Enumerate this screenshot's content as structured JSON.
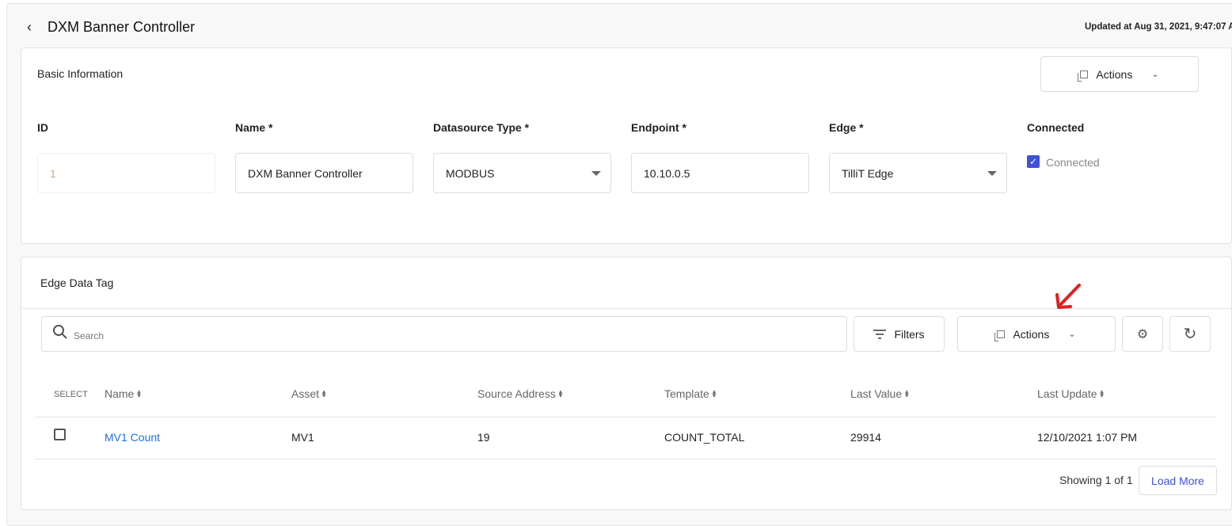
{
  "header": {
    "title": "DXM Banner Controller",
    "updated": "Updated at Aug 31, 2021, 9:47:07 A"
  },
  "basic": {
    "title": "Basic Information",
    "actions_label": "Actions",
    "fields": [
      {
        "label": "ID",
        "value": "1"
      },
      {
        "label": "Name *",
        "value": "DXM Banner Controller"
      },
      {
        "label": "Datasource Type *",
        "value": "MODBUS"
      },
      {
        "label": "Endpoint *",
        "value": "10.10.0.5"
      },
      {
        "label": "Edge *",
        "value": "TilliT Edge"
      }
    ],
    "connected": {
      "label": "Connected",
      "checkbox_label": "Connected",
      "checked": true
    }
  },
  "tags": {
    "title": "Edge Data Tag",
    "search_placeholder": "Search",
    "filters_label": "Filters",
    "actions_label": "Actions",
    "columns": [
      "SELECT",
      "Name",
      "Asset",
      "Source Address",
      "Template",
      "Last Value",
      "Last Update"
    ],
    "rows": [
      {
        "name": "MV1 Count",
        "asset": "MV1",
        "source": "19",
        "template": "COUNT_TOTAL",
        "last_value": "29914",
        "last_update": "12/10/2021 1:07 PM"
      }
    ],
    "showing": "Showing 1 of 1",
    "load_more": "Load More"
  },
  "colors": {
    "accent": "#3f51d6",
    "link": "#1a73e8",
    "annotation": "#e02020"
  }
}
